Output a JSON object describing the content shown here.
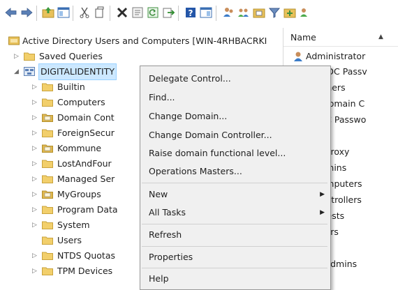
{
  "toolbar": {
    "icons": [
      "back-icon",
      "forward-icon",
      "up-folder-icon",
      "show-hide-tree-icon",
      "cut-icon",
      "copy-icon",
      "delete-icon",
      "properties-icon",
      "refresh-icon",
      "export-list-icon",
      "help-icon",
      "console-tree-icon",
      "users-icon",
      "groups-icon",
      "organizational-unit-icon",
      "filter-icon",
      "add-to-group-icon",
      "more-icon"
    ]
  },
  "tree": {
    "root": "Active Directory Users and Computers [WIN-4RHBACRKI",
    "saved_queries": "Saved Queries",
    "domain": "DIGITALIDENTITY",
    "children": [
      {
        "label": "Builtin",
        "type": "folder",
        "expandable": true
      },
      {
        "label": "Computers",
        "type": "folder",
        "expandable": true
      },
      {
        "label": "Domain Cont",
        "type": "ou",
        "expandable": true
      },
      {
        "label": "ForeignSecur",
        "type": "folder",
        "expandable": true
      },
      {
        "label": "Kommune",
        "type": "ou",
        "expandable": true
      },
      {
        "label": "LostAndFour",
        "type": "folder",
        "expandable": true
      },
      {
        "label": "Managed Ser",
        "type": "folder",
        "expandable": true
      },
      {
        "label": "MyGroups",
        "type": "ou",
        "expandable": true
      },
      {
        "label": "Program Data",
        "type": "folder",
        "expandable": true
      },
      {
        "label": "System",
        "type": "folder",
        "expandable": true
      },
      {
        "label": "Users",
        "type": "folder",
        "expandable": false
      },
      {
        "label": "NTDS Quotas",
        "type": "folder",
        "expandable": true
      },
      {
        "label": "TPM Devices",
        "type": "folder",
        "expandable": true
      }
    ]
  },
  "list": {
    "column_name": "Name",
    "rows": [
      {
        "label": "Administrator",
        "icon": "user"
      },
      {
        "label": "d RODC Passv",
        "icon": "none"
      },
      {
        "label": "ublishers",
        "icon": "none"
      },
      {
        "label": "ble Domain C",
        "icon": "none"
      },
      {
        "label": "RODC Passwo",
        "icon": "none"
      },
      {
        "label": "mins",
        "icon": "none"
      },
      {
        "label": "dateProxy",
        "icon": "none"
      },
      {
        "label": "n Admins",
        "icon": "none"
      },
      {
        "label": "n Computers",
        "icon": "none"
      },
      {
        "label": "n Controllers",
        "icon": "none"
      },
      {
        "label": "n Guests",
        "icon": "none"
      },
      {
        "label": "n Users",
        "icon": "none"
      },
      {
        "label": "",
        "icon": "none"
      },
      {
        "label": "rise Admins",
        "icon": "none"
      }
    ]
  },
  "context_menu": {
    "items": [
      {
        "label": "Delegate Control...",
        "submenu": false
      },
      {
        "label": "Find...",
        "submenu": false
      },
      {
        "label": "Change Domain...",
        "submenu": false
      },
      {
        "label": "Change Domain Controller...",
        "submenu": false
      },
      {
        "label": "Raise domain functional level...",
        "submenu": false
      },
      {
        "label": "Operations Masters...",
        "submenu": false
      },
      {
        "label": "New",
        "submenu": true
      },
      {
        "label": "All Tasks",
        "submenu": true
      },
      {
        "label": "Refresh",
        "submenu": false
      },
      {
        "label": "Properties",
        "submenu": false
      },
      {
        "label": "Help",
        "submenu": false
      }
    ]
  }
}
